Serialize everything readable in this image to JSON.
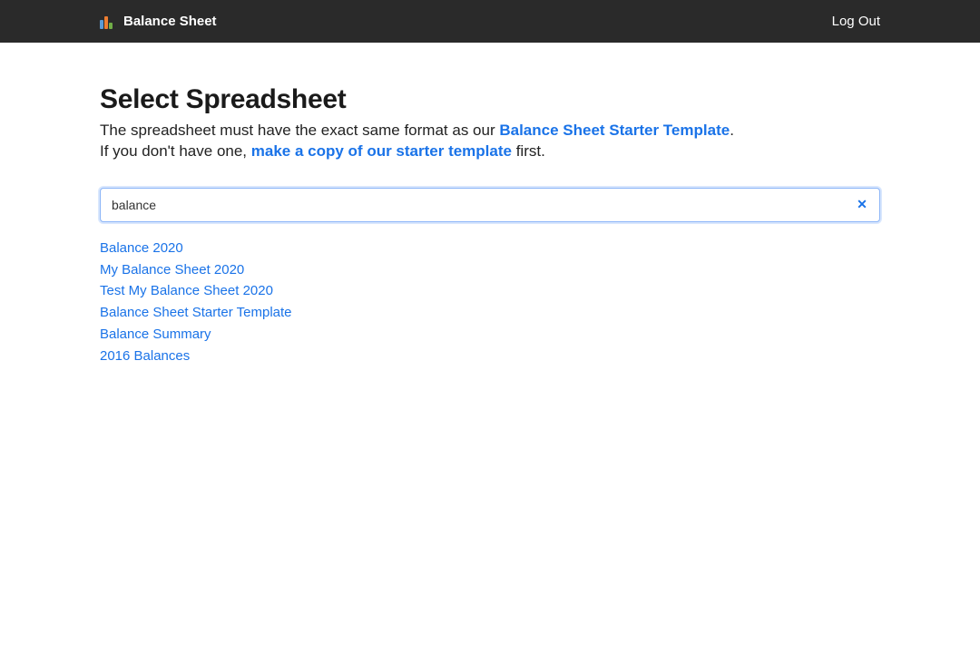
{
  "header": {
    "app_title": "Balance Sheet",
    "logout_label": "Log Out"
  },
  "main": {
    "title": "Select Spreadsheet",
    "instruction_part1": "The spreadsheet must have the exact same format as our ",
    "template_link_label": "Balance Sheet Starter Template",
    "instruction_part1_end": ".",
    "instruction_part2_start": "If you don't have one, ",
    "copy_link_label": "make a copy of our starter template",
    "instruction_part2_end": " first."
  },
  "search": {
    "value": "balance",
    "clear_icon_glyph": "✕"
  },
  "results": [
    "Balance 2020",
    "My Balance Sheet 2020",
    "Test My Balance Sheet 2020",
    "Balance Sheet Starter Template",
    "Balance Summary",
    "2016 Balances"
  ],
  "colors": {
    "topbar_bg": "#2a2a2a",
    "link": "#1a73e8",
    "input_border": "#8ab4f8"
  }
}
